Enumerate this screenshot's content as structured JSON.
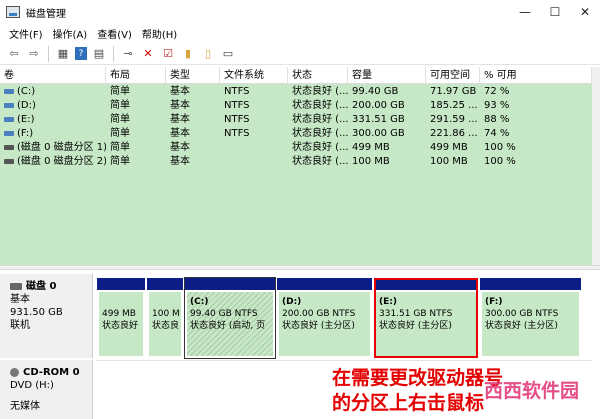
{
  "window": {
    "title": "磁盘管理"
  },
  "menu": [
    "文件(F)",
    "操作(A)",
    "查看(V)",
    "帮助(H)"
  ],
  "toolbar": [
    "back-icon",
    "forward-icon",
    "properties-icon",
    "help-icon",
    "connect-icon",
    "delete-icon",
    "check-icon",
    "open-icon",
    "explore-icon",
    "settings-icon"
  ],
  "volume_table": {
    "columns": [
      "卷",
      "布局",
      "类型",
      "文件系统",
      "状态",
      "容量",
      "可用空间",
      "% 可用"
    ],
    "rows": [
      [
        "(C:)",
        "简单",
        "基本",
        "NTFS",
        "状态良好 (...",
        "99.40 GB",
        "71.97 GB",
        "72 %"
      ],
      [
        "(D:)",
        "简单",
        "基本",
        "NTFS",
        "状态良好 (...",
        "200.00 GB",
        "185.25 ...",
        "93 %"
      ],
      [
        "(E:)",
        "简单",
        "基本",
        "NTFS",
        "状态良好 (...",
        "331.51 GB",
        "291.59 ...",
        "88 %"
      ],
      [
        "(F:)",
        "简单",
        "基本",
        "NTFS",
        "状态良好 (...",
        "300.00 GB",
        "221.86 ...",
        "74 %"
      ],
      [
        "(磁盘 0 磁盘分区 1)",
        "简单",
        "基本",
        "",
        "状态良好 (...",
        "499 MB",
        "499 MB",
        "100 %"
      ],
      [
        "(磁盘 0 磁盘分区 2)",
        "简单",
        "基本",
        "",
        "状态良好 (...",
        "100 MB",
        "100 MB",
        "100 %"
      ]
    ]
  },
  "disk0": {
    "name": "磁盘 0",
    "type": "基本",
    "size": "931.50 GB",
    "status": "联机",
    "partitions": [
      {
        "name": "",
        "size": "499 MB",
        "status": "状态良好"
      },
      {
        "name": "",
        "size": "100 M",
        "status": "状态良"
      },
      {
        "name": "(C:)",
        "size": "99.40 GB NTFS",
        "status": "状态良好 (启动, 页"
      },
      {
        "name": "(D:)",
        "size": "200.00 GB NTFS",
        "status": "状态良好 (主分区)"
      },
      {
        "name": "(E:)",
        "size": "331.51 GB NTFS",
        "status": "状态良好 (主分区)"
      },
      {
        "name": "(F:)",
        "size": "300.00 GB NTFS",
        "status": "状态良好 (主分区)"
      }
    ]
  },
  "cdrom": {
    "name": "CD-ROM 0",
    "drive": "DVD (H:)",
    "media": "无媒体"
  },
  "annotation": {
    "line1": "在需要更改驱动器号",
    "line2": "的分区上右击鼠标"
  },
  "watermark": "西西软件园"
}
